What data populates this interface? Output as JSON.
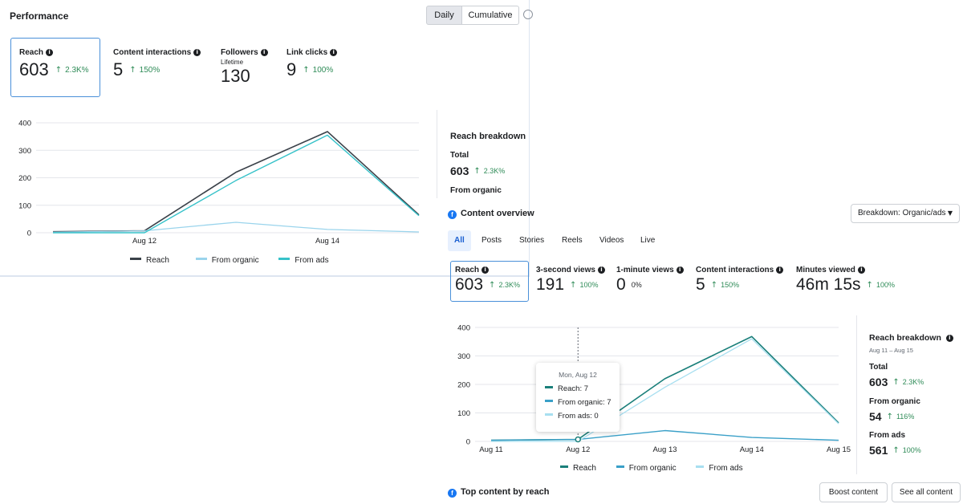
{
  "performance": {
    "title": "Performance",
    "toggle": {
      "daily": "Daily",
      "cumulative": "Cumulative"
    },
    "metrics": [
      {
        "label": "Reach",
        "value": "603",
        "change": "2.3K%"
      },
      {
        "label": "Content interactions",
        "value": "5",
        "change": "150%"
      },
      {
        "label": "Followers",
        "sublabel": "Lifetime",
        "value": "130"
      },
      {
        "label": "Link clicks",
        "value": "9",
        "change": "100%"
      }
    ],
    "legend": {
      "reach": "Reach",
      "organic": "From organic",
      "ads": "From ads"
    }
  },
  "reach_breakdown_top": {
    "title": "Reach breakdown",
    "total_label": "Total",
    "total_value": "603",
    "total_change": "2.3K%",
    "organic_label": "From organic"
  },
  "content_overview": {
    "title": "Content overview",
    "breakdown_select": "Breakdown: Organic/ads",
    "tabs": [
      "All",
      "Posts",
      "Stories",
      "Reels",
      "Videos",
      "Live"
    ],
    "metrics": [
      {
        "label": "Reach",
        "value": "603",
        "change": "2.3K%"
      },
      {
        "label": "3-second views",
        "value": "191",
        "change": "100%"
      },
      {
        "label": "1-minute views",
        "value": "0",
        "change": "0%"
      },
      {
        "label": "Content interactions",
        "value": "5",
        "change": "150%"
      },
      {
        "label": "Minutes viewed",
        "value": "46m 15s",
        "change": "100%"
      }
    ],
    "tooltip": {
      "date": "Mon, Aug 12",
      "reach": "Reach: 7",
      "organic": "From organic: 7",
      "ads": "From ads: 0"
    },
    "legend": {
      "reach": "Reach",
      "organic": "From organic",
      "ads": "From ads"
    },
    "breakdown": {
      "title": "Reach breakdown",
      "range": "Aug 11 – Aug 15",
      "total_label": "Total",
      "total_value": "603",
      "total_change": "2.3K%",
      "organic_label": "From organic",
      "organic_value": "54",
      "organic_change": "116%",
      "ads_label": "From ads",
      "ads_value": "561",
      "ads_change": "100%"
    }
  },
  "top_content": {
    "title": "Top content by reach",
    "boost": "Boost content",
    "see_all": "See all content"
  },
  "colors": {
    "reach": "#3a4149",
    "organic": "#9ad4ec",
    "ads": "#37c2c9",
    "reach2": "#1a7f7a",
    "organic2": "#3aa0c8",
    "ads2": "#a8dff0"
  },
  "chart_data": [
    {
      "type": "line",
      "x": [
        "Aug 11",
        "Aug 12",
        "Aug 13",
        "Aug 14",
        "Aug 15"
      ],
      "x_tick_labels": [
        "Aug 12",
        "Aug 14"
      ],
      "ylim": [
        0,
        400
      ],
      "y_ticks": [
        0,
        100,
        200,
        300,
        400
      ],
      "grid": true,
      "legend_placement": "bottom",
      "series": [
        {
          "name": "Reach",
          "values": [
            4,
            7,
            220,
            368,
            65
          ]
        },
        {
          "name": "From organic",
          "values": [
            2,
            7,
            38,
            12,
            3
          ]
        },
        {
          "name": "From ads",
          "values": [
            0,
            0,
            190,
            355,
            62
          ]
        }
      ]
    },
    {
      "type": "line",
      "x": [
        "Aug 11",
        "Aug 12",
        "Aug 13",
        "Aug 14",
        "Aug 15"
      ],
      "ylim": [
        0,
        400
      ],
      "y_ticks": [
        0,
        100,
        200,
        300,
        400
      ],
      "grid": true,
      "legend_placement": "bottom",
      "series": [
        {
          "name": "Reach",
          "values": [
            4,
            7,
            220,
            368,
            65
          ]
        },
        {
          "name": "From organic",
          "values": [
            4,
            7,
            38,
            14,
            4
          ]
        },
        {
          "name": "From ads",
          "values": [
            0,
            0,
            190,
            360,
            62
          ]
        }
      ]
    }
  ]
}
